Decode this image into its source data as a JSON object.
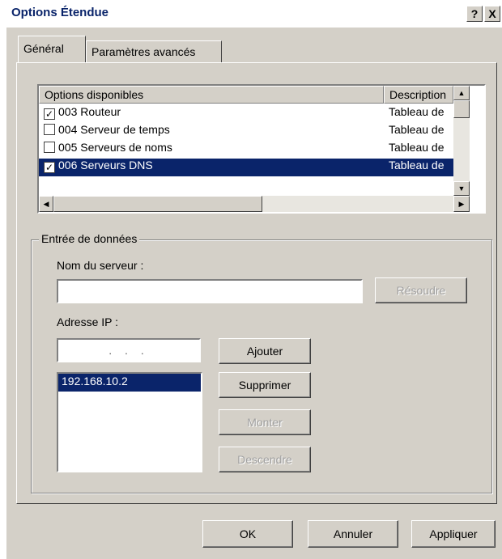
{
  "window": {
    "title": "Options Étendue",
    "help_label": "?",
    "close_label": "X"
  },
  "tabs": [
    {
      "label": "Général"
    },
    {
      "label": "Paramètres avancés"
    }
  ],
  "options_list": {
    "columns": [
      "Options disponibles",
      "Description"
    ],
    "rows": [
      {
        "name": "003 Routeur",
        "description": "Tableau de",
        "checked": true,
        "selected": false
      },
      {
        "name": "004 Serveur de temps",
        "description": "Tableau de",
        "checked": false,
        "selected": false
      },
      {
        "name": "005 Serveurs de noms",
        "description": "Tableau de",
        "checked": false,
        "selected": false
      },
      {
        "name": "006 Serveurs DNS",
        "description": "Tableau de",
        "checked": true,
        "selected": true
      }
    ]
  },
  "data_entry": {
    "group_label": "Entrée de données",
    "server_name_label": "Nom du serveur :",
    "server_name_value": "",
    "resolve_button": "Résoudre",
    "ip_label": "Adresse IP :",
    "ip_value": ".   .   .",
    "add_button": "Ajouter",
    "ip_list": [
      "192.168.10.2"
    ],
    "remove_button": "Supprimer",
    "up_button": "Monter",
    "down_button": "Descendre"
  },
  "footer": {
    "ok": "OK",
    "cancel": "Annuler",
    "apply": "Appliquer"
  }
}
